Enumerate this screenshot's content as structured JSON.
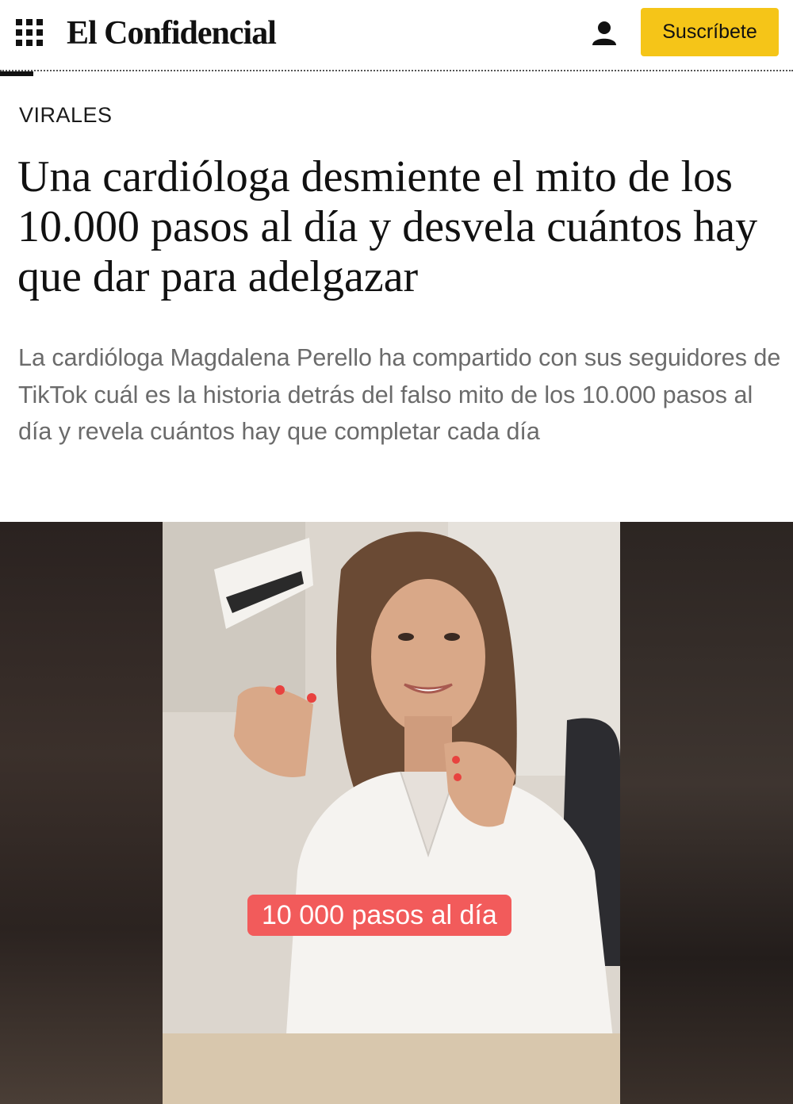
{
  "header": {
    "logo": "El Confidencial",
    "subscribe_label": "Suscríbete",
    "menu_icon": "grid-menu-icon",
    "user_icon": "user-icon",
    "accent_color": "#f5c518"
  },
  "article": {
    "section": "VIRALES",
    "headline": "Una cardióloga desmiente el mito de los 10.000 pasos al día y desvela cuántos hay que dar para adelgazar",
    "standfirst": "La cardióloga Magdalena Perello ha compartido con sus seguidores de TikTok cuál es la historia detrás del falso mito de los 10.000 pasos al día y revela cuántos hay que completar cada día"
  },
  "media": {
    "caption": "10 000 pasos al día",
    "caption_color": "#f25b5b"
  }
}
